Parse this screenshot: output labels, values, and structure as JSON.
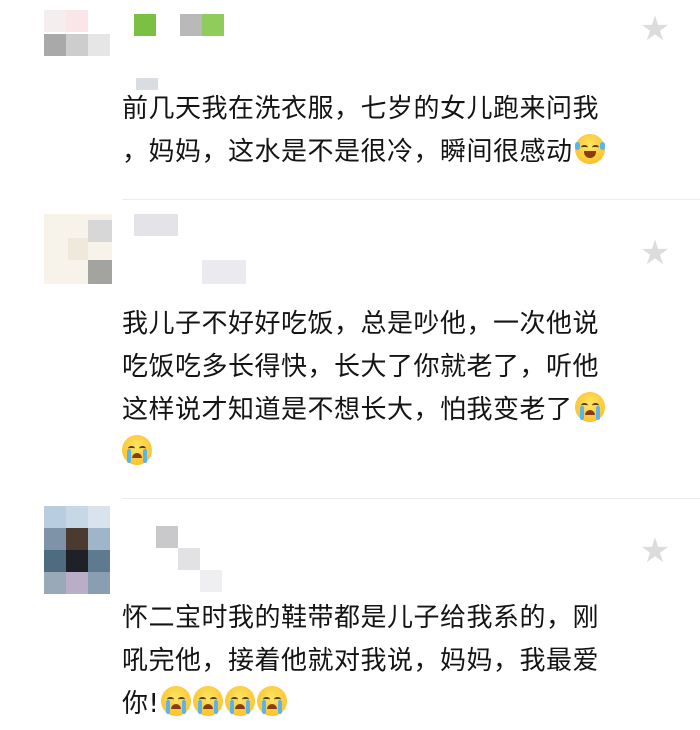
{
  "comments": [
    {
      "lines": [
        "前几天我在洗衣服，七岁的女儿跑来问我",
        "，妈妈，这水是不是很冷，瞬间很感动"
      ],
      "emoji": "laughing-with-tears-emoji",
      "star_icon": "star-icon"
    },
    {
      "lines": [
        "我儿子不好好吃饭，总是吵他，一次他说",
        "吃饭吃多长得快，长大了你就老了，听他",
        "这样说才知道是不想长大，怕我变老了"
      ],
      "emoji": "crying-emoji",
      "star_icon": "star-icon"
    },
    {
      "lines": [
        "怀二宝时我的鞋带都是儿子给我系的，刚",
        "吼完他，接着他就对我说，妈妈，我最爱",
        "你!"
      ],
      "emoji": "crying-emoji",
      "star_icon": "star-icon"
    }
  ],
  "colors": {
    "text": "#141414",
    "star": "#dcdcdc",
    "divider": "#ececec",
    "background": "#ffffff"
  }
}
